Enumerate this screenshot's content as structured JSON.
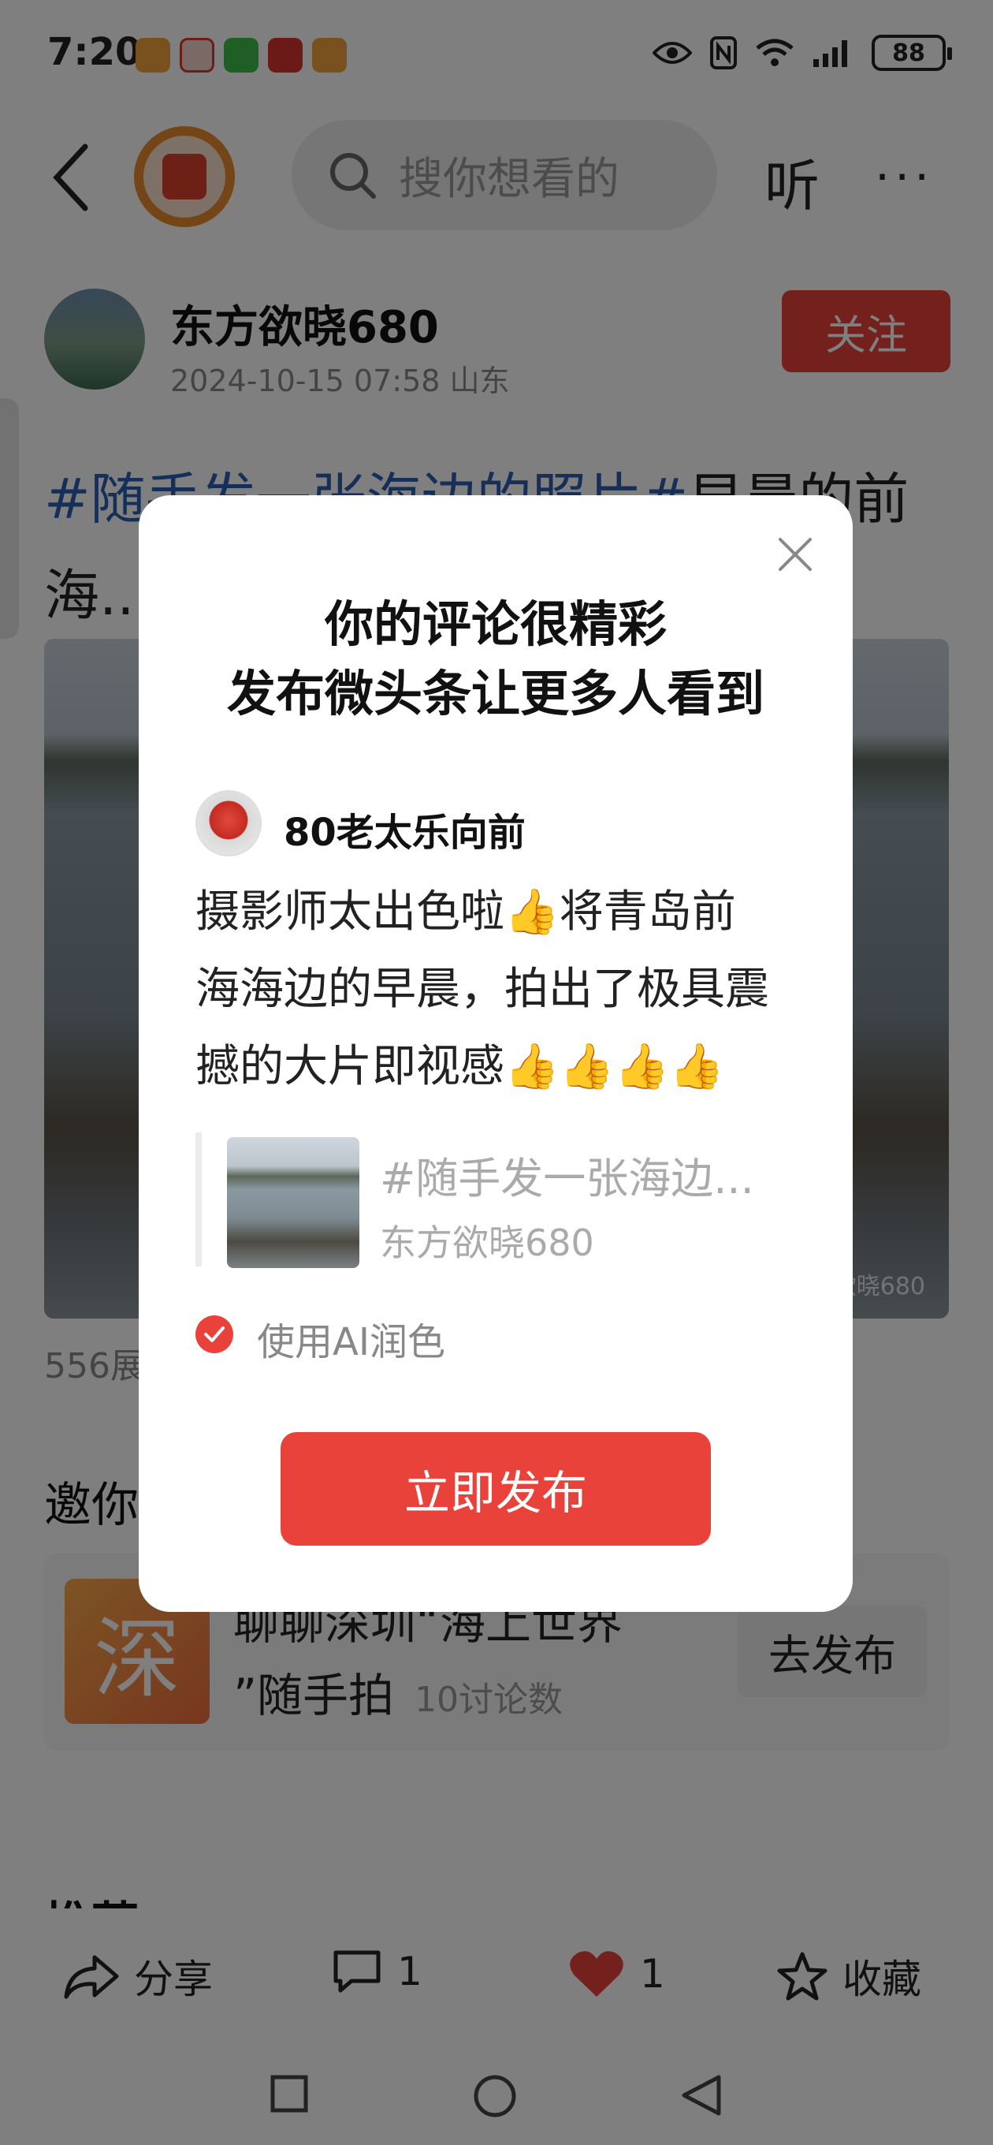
{
  "status_bar": {
    "time": "7:20",
    "battery": "88",
    "notification_icons": [
      "app-icon-orange",
      "app-icon-red-face",
      "wechat-icon",
      "huawei-icon",
      "app-icon-orange"
    ],
    "status_icons": [
      "eye-icon",
      "nfc-icon",
      "wifi-icon",
      "signal-icon"
    ]
  },
  "top_nav": {
    "search_placeholder": "搜你想看的",
    "listen_label": "听",
    "more_label": "···"
  },
  "author": {
    "name": "东方欲晓680",
    "meta": "2024-10-15 07:58 山东",
    "follow_label": "关注"
  },
  "post": {
    "title_tag": "#随手发一张海边的照片#",
    "title_rest": "早晨的前海...",
    "image_watermark": "欲晓680",
    "views": "556展"
  },
  "invite": {
    "title": "邀你",
    "topic_thumb_char": "深",
    "topic_line1": "聊聊深圳“海上世界",
    "topic_line2": "”随手拍",
    "topic_count": "10讨论数",
    "topic_button": "去发布",
    "next_section_title": "推荐"
  },
  "action_bar": {
    "share_label": "分享",
    "comment_count": "1",
    "like_count": "1",
    "favorite_label": "收藏"
  },
  "modal": {
    "title_line1": "你的评论很精彩",
    "title_line2": "发布微头条让更多人看到",
    "commenter": "80老太乐向前",
    "comment_line1": "摄影师太出色啦👍将青岛前",
    "comment_line2": "海海边的早晨，拍出了极具震",
    "comment_line3": "撼的大片即视感👍👍👍👍",
    "quote_title": "#随手发一张海边...",
    "quote_author": "东方欲晓680",
    "ai_label": "使用AI润色",
    "publish_label": "立即发布"
  },
  "colors": {
    "accent_red": "#e8423a",
    "tag_blue": "#2d5fb0",
    "overlay": "rgba(0,0,0,0.5)"
  }
}
